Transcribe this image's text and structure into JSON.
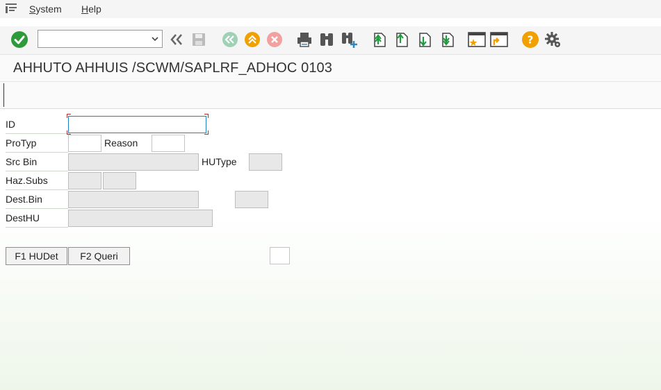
{
  "menu": {
    "items": [
      "System",
      "Help"
    ],
    "mnemonics": [
      "S",
      "H"
    ],
    "rests": [
      "ystem",
      "elp"
    ]
  },
  "toolbar": {
    "command_value": "",
    "command_placeholder": "",
    "icons": [
      "enter-icon",
      "back-icon",
      "save-icon",
      "exit-icon",
      "up-icon",
      "cancel-icon",
      "print-icon",
      "find-icon",
      "find-next-icon",
      "first-page-icon",
      "previous-page-icon",
      "next-page-icon",
      "last-page-icon",
      "create-session-icon",
      "shortcut-icon",
      "help-icon",
      "settings-icon"
    ],
    "colors": {
      "green": "#2e9b3a",
      "orange": "#f0a000",
      "red": "#e05050",
      "teal": "#7fc4a0",
      "dark": "#555555"
    }
  },
  "title": "AHHUTO AHHUIS /SCWM/SAPLRF_ADHOC 0103",
  "form": {
    "id_label": "ID",
    "id_value": "",
    "protyp_label": "ProTyp",
    "protyp_value": "",
    "reason_label": "Reason",
    "reason_value": "",
    "srcbin_label": "Src Bin",
    "srcbin_value": "",
    "hutype_label": "HUType",
    "hutype_value": "",
    "hazsubs_label": "Haz.Subs",
    "hazsubs_value1": "",
    "hazsubs_value2": "",
    "destbin_label": "Dest.Bin",
    "destbin_value": "",
    "destbin_extra_value": "",
    "desthu_label": "DestHU",
    "desthu_value": ""
  },
  "buttons": {
    "f1": "F1 HUDet",
    "f2": "F2 Queri"
  },
  "extra_field_value": ""
}
